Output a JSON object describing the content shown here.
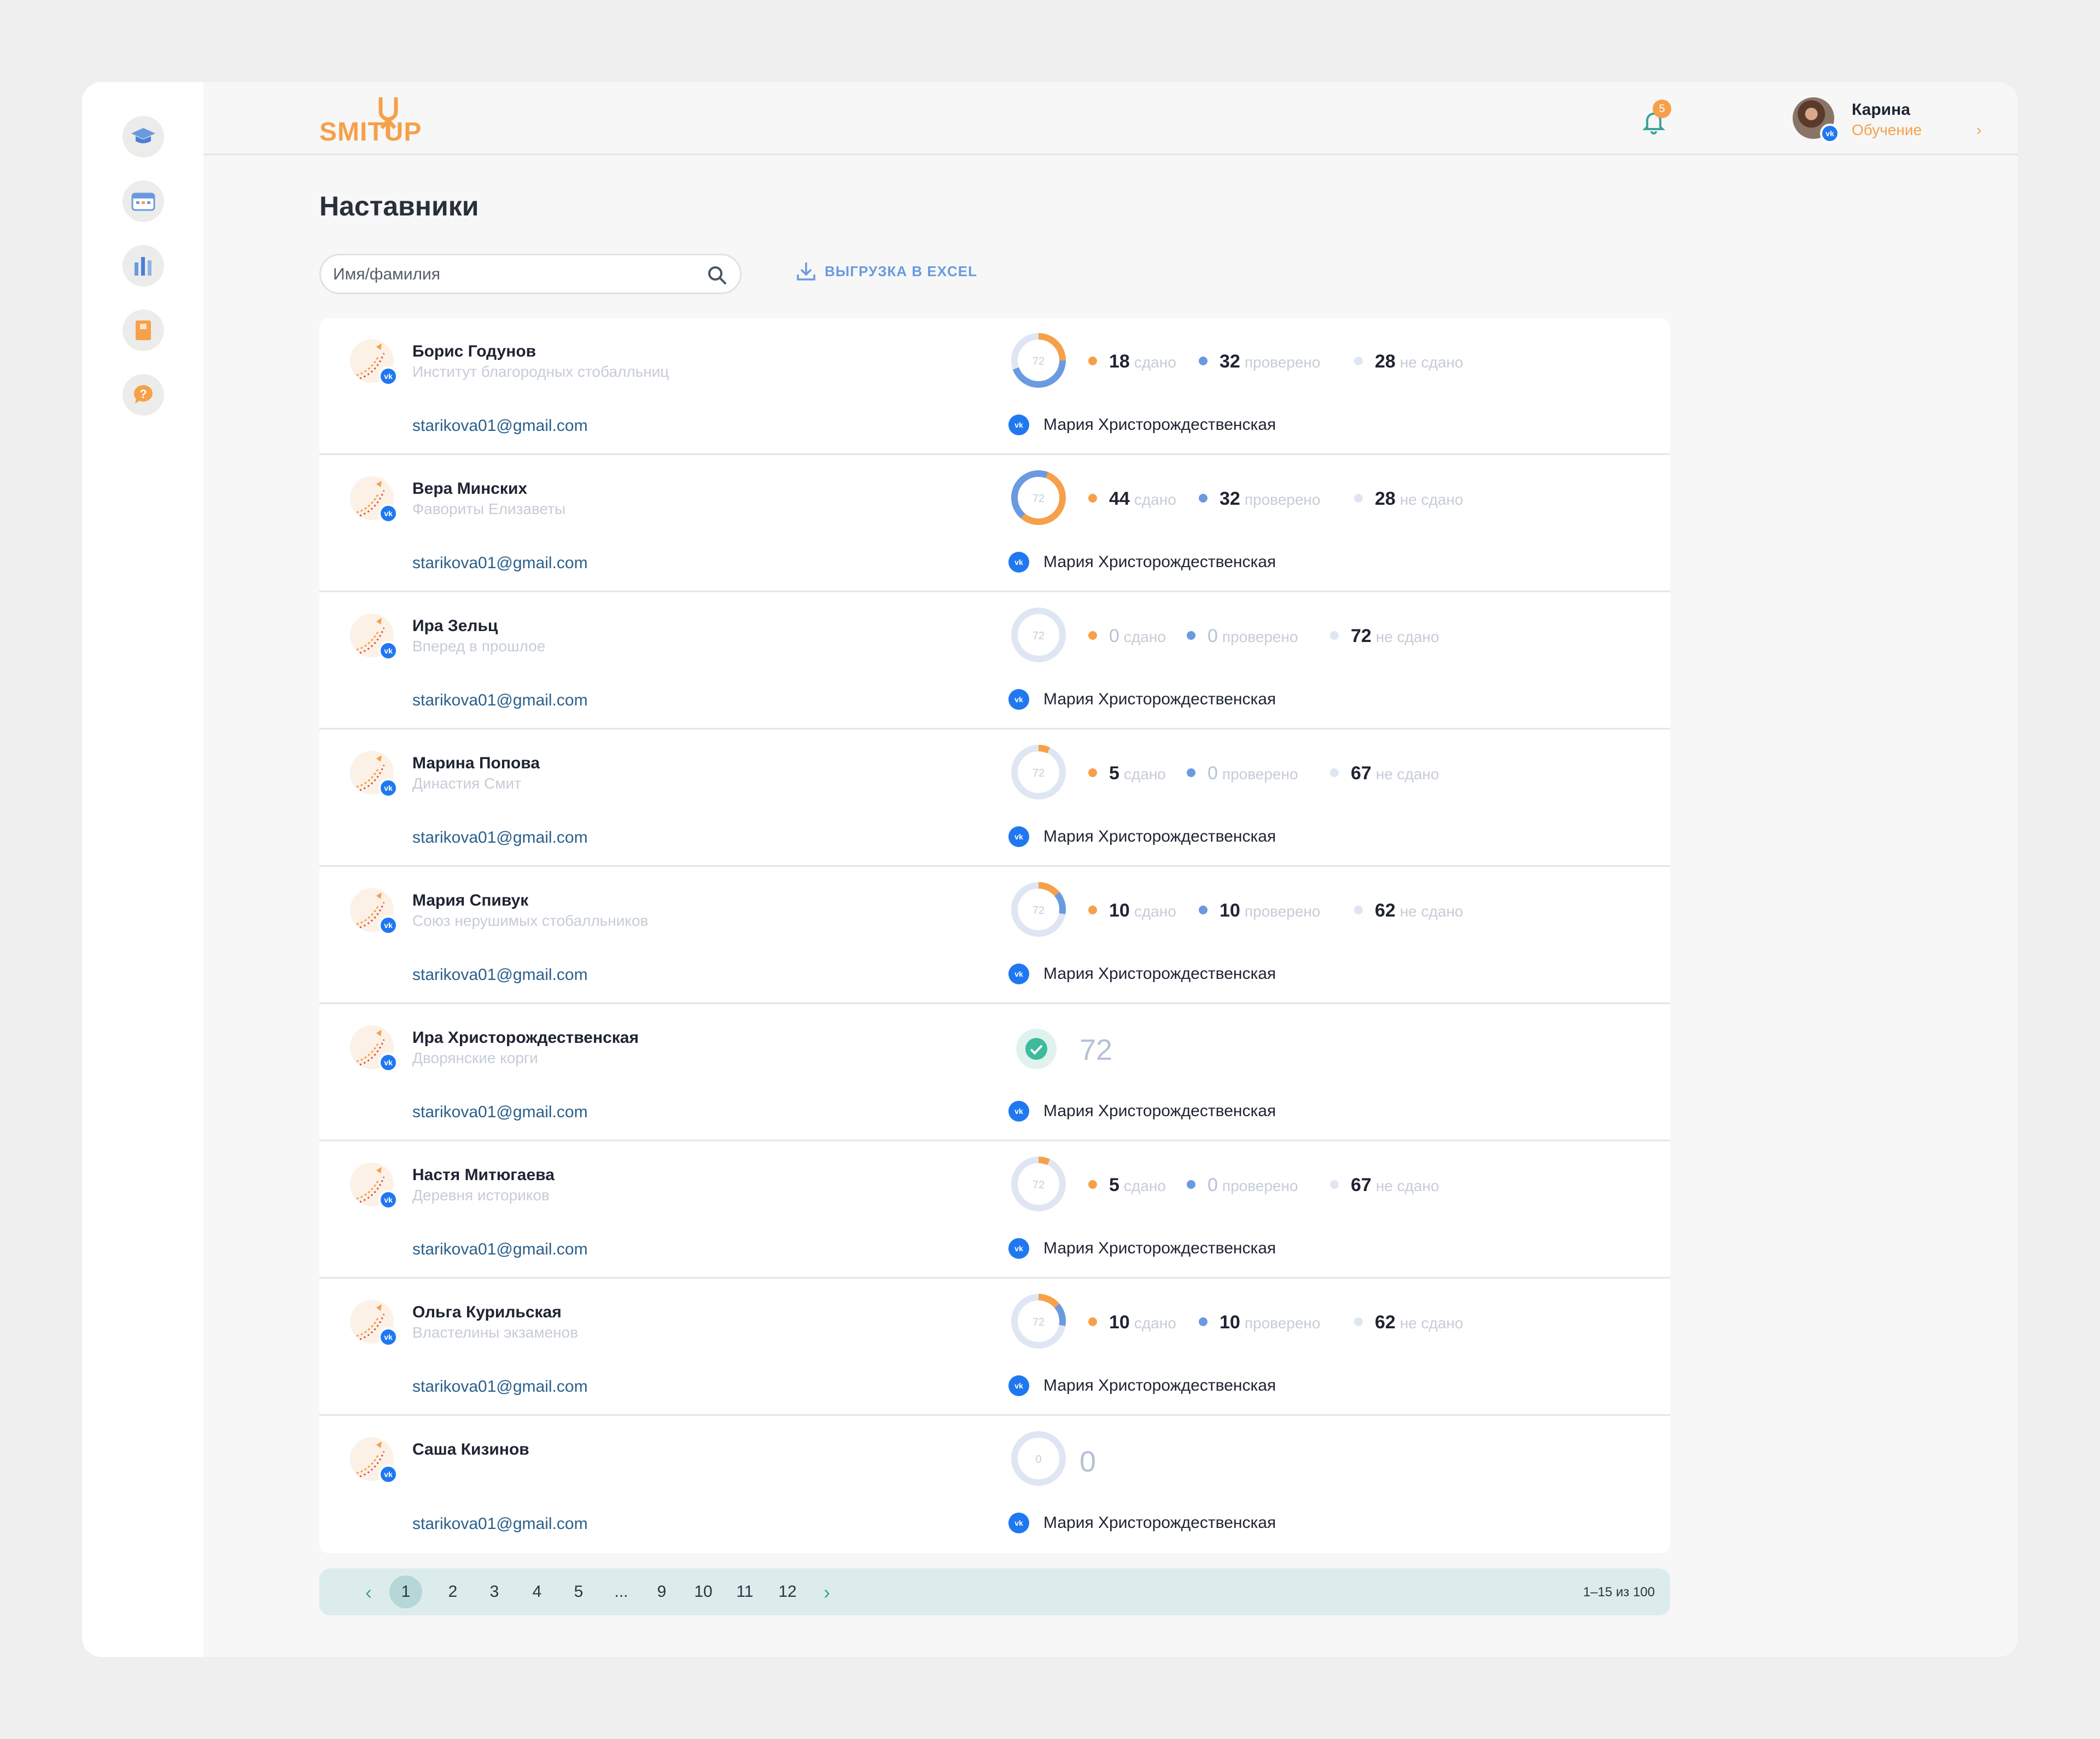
{
  "brand": {
    "logo_text": "SMITUP"
  },
  "colors": {
    "accent": "#f6a04a",
    "blue": "#6a9ae0",
    "vk": "#1f78f0",
    "teal": "#3aa39a"
  },
  "sidebar": {
    "items": [
      {
        "icon": "graduation-cap-icon"
      },
      {
        "icon": "calendar-icon"
      },
      {
        "icon": "stats-icon"
      },
      {
        "icon": "book-icon"
      },
      {
        "icon": "help-icon"
      }
    ]
  },
  "header": {
    "notifications": "5",
    "user_name": "Карина",
    "user_role": "Обучение",
    "user_chevron": "›"
  },
  "page": {
    "title": "Наставники"
  },
  "search": {
    "placeholder": "Имя/фамилия"
  },
  "export": {
    "label": "ВЫГРУЗКА В EXCEL"
  },
  "labels": {
    "passed": "сдано",
    "checked": "проверено",
    "not_passed": "не сдано"
  },
  "rows": [
    {
      "name": "Борис Годунов",
      "org": "Институт благородных стобалльниц",
      "email": "starikova01@gmail.com",
      "mentor": "Мария Христорождественская",
      "type": "stats",
      "total": "72",
      "passed": "18",
      "checked": "32",
      "not_passed": "28"
    },
    {
      "name": "Вера Минских",
      "org": "Фавориты Елизаветы",
      "email": "starikova01@gmail.com",
      "mentor": "Мария Христорождественская",
      "type": "stats",
      "total": "72",
      "passed": "44",
      "checked": "32",
      "not_passed": "28"
    },
    {
      "name": "Ира Зельц",
      "org": "Вперед в прошлое",
      "email": "starikova01@gmail.com",
      "mentor": "Мария Христорождественская",
      "type": "stats",
      "total": "72",
      "passed": "0",
      "checked": "0",
      "not_passed": "72"
    },
    {
      "name": "Марина Попова",
      "org": "Династия Смит",
      "email": "starikova01@gmail.com",
      "mentor": "Мария Христорождественская",
      "type": "stats",
      "total": "72",
      "passed": "5",
      "checked": "0",
      "not_passed": "67"
    },
    {
      "name": "Мария Спивук",
      "org": "Союз нерушимых стобалльников",
      "email": "starikova01@gmail.com",
      "mentor": "Мария Христорождественская",
      "type": "stats",
      "total": "72",
      "passed": "10",
      "checked": "10",
      "not_passed": "62"
    },
    {
      "name": "Ира Христорождественская",
      "org": "Дворянские корги",
      "email": "starikova01@gmail.com",
      "mentor": "Мария Христорождественская",
      "type": "done",
      "total": "72"
    },
    {
      "name": "Настя Митюгаева",
      "org": "Деревня историков",
      "email": "starikova01@gmail.com",
      "mentor": "Мария Христорождественская",
      "type": "stats",
      "total": "72",
      "passed": "5",
      "checked": "0",
      "not_passed": "67"
    },
    {
      "name": "Ольга Курильская",
      "org": "Властелины экзаменов",
      "email": "starikova01@gmail.com",
      "mentor": "Мария Христорождественская",
      "type": "stats",
      "total": "72",
      "passed": "10",
      "checked": "10",
      "not_passed": "62"
    },
    {
      "name": "Саша Кизинов",
      "org": "",
      "email": "starikova01@gmail.com",
      "mentor": "Мария Христорождественская",
      "type": "empty",
      "total": "0"
    }
  ],
  "pagination": {
    "pages": [
      "1",
      "2",
      "3",
      "4",
      "5",
      "...",
      "9",
      "10",
      "11",
      "12"
    ],
    "current": "1",
    "prev": "‹",
    "next": "›",
    "info": "1–15 из 100"
  }
}
